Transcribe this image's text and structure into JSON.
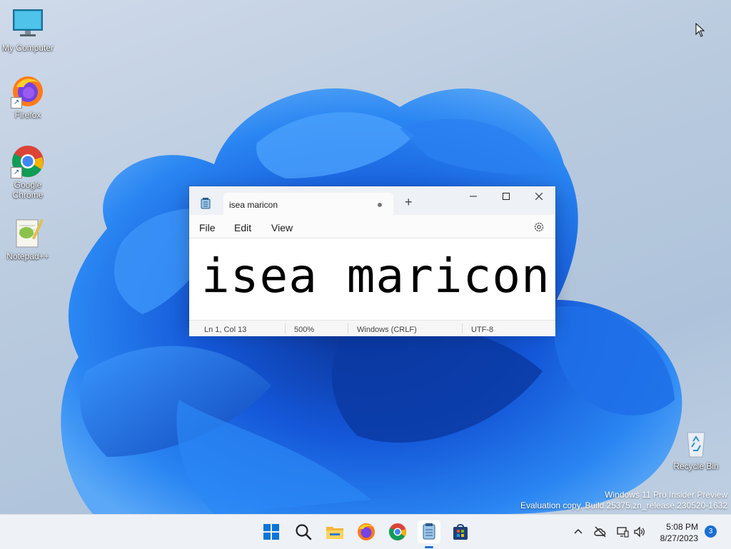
{
  "desktop": {
    "icons": [
      {
        "label": "My Computer"
      },
      {
        "label": "Firefox"
      },
      {
        "label": "Google Chrome"
      },
      {
        "label": "Notepad++"
      },
      {
        "label": "Recycle Bin"
      }
    ],
    "watermark": {
      "line1": "Windows 11 Pro Insider Preview",
      "line2": "Evaluation copy. Build 25375.zn_release.230520-1632"
    }
  },
  "notepad": {
    "tab_title": "isea maricon",
    "new_tab_symbol": "+",
    "menu": {
      "file": "File",
      "edit": "Edit",
      "view": "View"
    },
    "content": "isea maricon",
    "status": {
      "position": "Ln 1, Col 13",
      "zoom": "500%",
      "line_ending": "Windows (CRLF)",
      "encoding": "UTF-8"
    }
  },
  "taskbar": {
    "apps": [
      "start-icon",
      "search-icon",
      "file-explorer-icon",
      "firefox-icon",
      "chrome-icon",
      "notepad-icon",
      "store-icon"
    ],
    "clock": {
      "time": "5:08 PM",
      "date": "8/27/2023"
    },
    "notification_count": "3"
  },
  "colors": {
    "accent": "#1a6fd4",
    "bloom": "#1769e6"
  }
}
